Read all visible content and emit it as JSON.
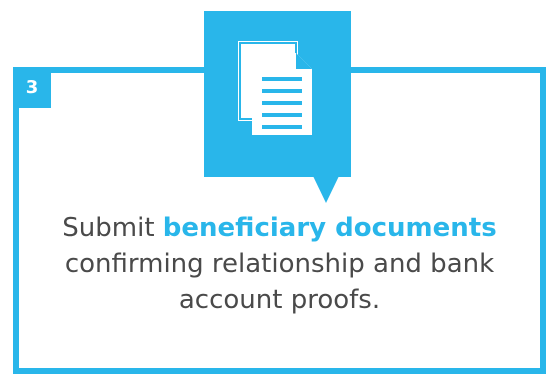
{
  "step": {
    "number": "3"
  },
  "icon": {
    "name": "document-icon"
  },
  "message": {
    "prefix": "Submit ",
    "highlight": "beneficiary documents",
    "suffix": " confirming relationship and bank account proofs."
  },
  "colors": {
    "accent": "#29b6ea",
    "text": "#4a4a4a",
    "background": "#ffffff"
  }
}
